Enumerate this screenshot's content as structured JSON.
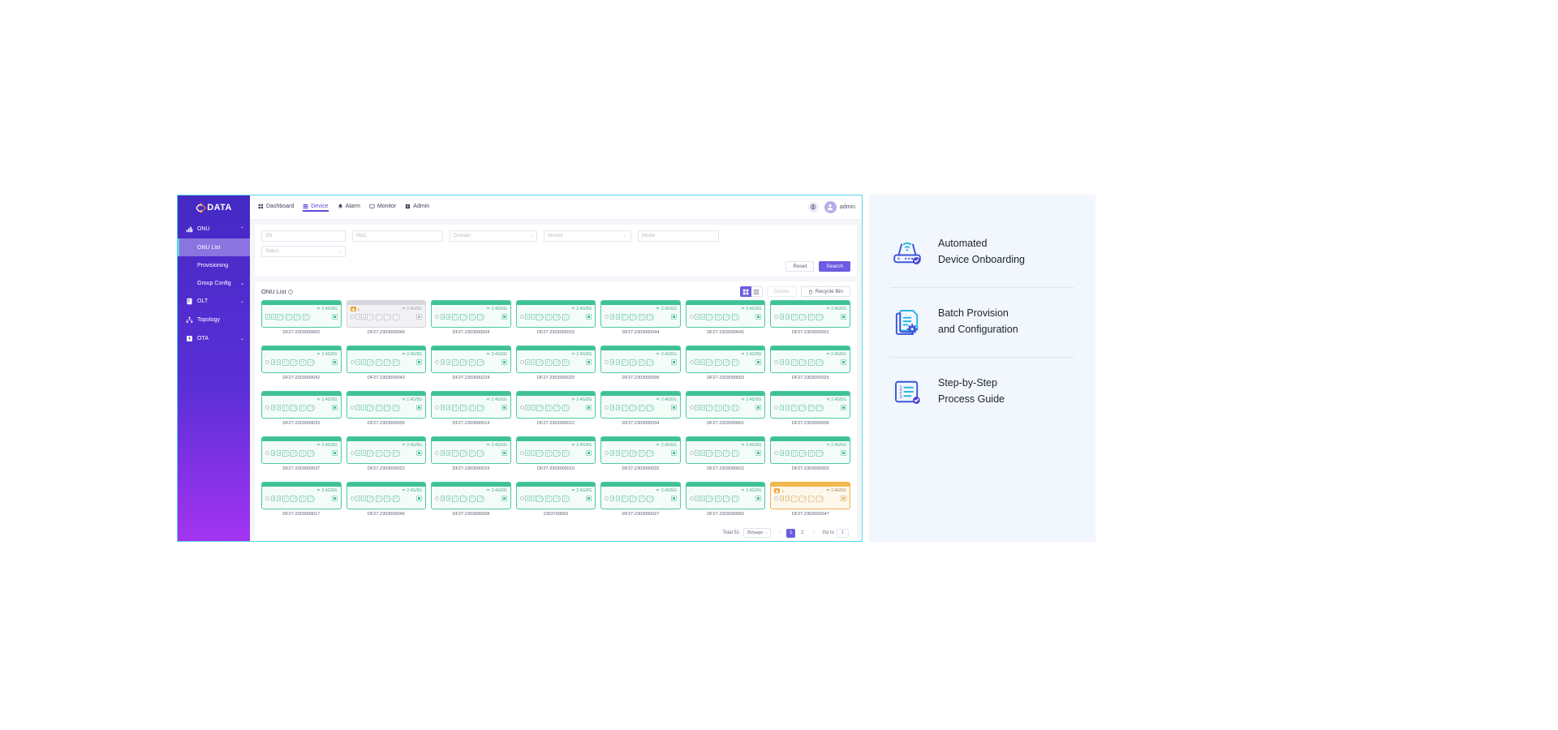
{
  "brand": {
    "name": "DATA",
    "logo_icon": "cdata-diamond-logo"
  },
  "sidebar": {
    "groups": [
      {
        "label": "ONU",
        "icon": "onu-device-icon",
        "expanded": true,
        "caret": "⌃",
        "children": [
          {
            "label": "ONU List",
            "active": true
          },
          {
            "label": "Provisioning",
            "active": false
          },
          {
            "label": "Group Config",
            "active": false,
            "caret": "⌄"
          }
        ]
      },
      {
        "label": "OLT",
        "icon": "olt-rack-icon",
        "caret": "⌄",
        "children": []
      },
      {
        "label": "Topology",
        "icon": "topology-icon",
        "caret": "",
        "children": []
      },
      {
        "label": "OTA",
        "icon": "ota-upgrade-icon",
        "caret": "⌄",
        "children": []
      }
    ]
  },
  "topnav": {
    "items": [
      {
        "label": "Dashboard",
        "icon": "dashboard-grid-icon",
        "active": false
      },
      {
        "label": "Device",
        "icon": "device-stack-icon",
        "active": true
      },
      {
        "label": "Alarm",
        "icon": "alarm-bell-icon",
        "active": false
      },
      {
        "label": "Monitor",
        "icon": "monitor-screen-icon",
        "active": false
      },
      {
        "label": "Admin",
        "icon": "admin-shield-icon",
        "active": false
      }
    ],
    "language_icon": "globe-icon",
    "avatar_icon": "user-avatar-icon",
    "user": "admin"
  },
  "filters": {
    "sn": {
      "placeholder": "SN",
      "value": ""
    },
    "mac": {
      "placeholder": "MAC",
      "value": ""
    },
    "domain": {
      "placeholder": "Domain",
      "value": "",
      "chevron": "⌄"
    },
    "vendor": {
      "placeholder": "Vendor",
      "value": "",
      "chevron": "⌄"
    },
    "model": {
      "placeholder": "Model",
      "value": ""
    },
    "status": {
      "placeholder": "Status",
      "value": "",
      "chevron": "⌄"
    },
    "reset_label": "Reset",
    "search_label": "Search"
  },
  "list": {
    "title": "ONU List",
    "info_icon": "info-circle-icon",
    "grid_view_icon": "grid-view-icon",
    "list_view_icon": "list-view-icon",
    "grid_active": true,
    "delete_label": "Delete",
    "delete_disabled": true,
    "recycle_label": "Recycle Bin",
    "recycle_icon": "trash-icon",
    "wifi_icon": "wifi-icon",
    "alarm_icon": "alarm-triangle-icon"
  },
  "devices": [
    {
      "sn": "DF27-2303000002",
      "state": "online",
      "wifi": "2.4G/5G",
      "leds": 0,
      "small_ports": 2,
      "large_ports": 4,
      "alarm": null
    },
    {
      "sn": "DF27-2303000045",
      "state": "offline",
      "wifi": "2.4G/5G",
      "leds": 1,
      "small_ports": 2,
      "large_ports": 4,
      "alarm": "1"
    },
    {
      "sn": "DF27-2303000004",
      "state": "online",
      "wifi": "2.4G/5G",
      "leds": 1,
      "small_ports": 2,
      "large_ports": 4,
      "alarm": null
    },
    {
      "sn": "DF27-2303000015",
      "state": "online",
      "wifi": "2.4G/5G",
      "leds": 1,
      "small_ports": 2,
      "large_ports": 4,
      "alarm": null
    },
    {
      "sn": "DF27-2303000044",
      "state": "online",
      "wifi": "2.4G/5G",
      "leds": 1,
      "small_ports": 2,
      "large_ports": 4,
      "alarm": null
    },
    {
      "sn": "DF27-2303000041",
      "state": "online",
      "wifi": "2.4G/5G",
      "leds": 1,
      "small_ports": 2,
      "large_ports": 4,
      "alarm": null
    },
    {
      "sn": "DF27-2303000001",
      "state": "online",
      "wifi": "2.4G/5G",
      "leds": 1,
      "small_ports": 2,
      "large_ports": 4,
      "alarm": null
    },
    {
      "sn": "DF27-2303000042",
      "state": "online",
      "wifi": "2.4G/5G",
      "leds": 1,
      "small_ports": 2,
      "large_ports": 4,
      "alarm": null
    },
    {
      "sn": "DF27-2303000043",
      "state": "online",
      "wifi": "2.4G/5G",
      "leds": 1,
      "small_ports": 2,
      "large_ports": 4,
      "alarm": null
    },
    {
      "sn": "DF27-2303000224",
      "state": "online",
      "wifi": "2.4G/5G",
      "leds": 1,
      "small_ports": 2,
      "large_ports": 4,
      "alarm": null
    },
    {
      "sn": "DF27-2303000029",
      "state": "online",
      "wifi": "2.4G/5G",
      "leds": 1,
      "small_ports": 2,
      "large_ports": 4,
      "alarm": null
    },
    {
      "sn": "DF27-2303000006",
      "state": "online",
      "wifi": "2.4G/5G",
      "leds": 1,
      "small_ports": 2,
      "large_ports": 4,
      "alarm": null
    },
    {
      "sn": "DF27-2303000003",
      "state": "online",
      "wifi": "2.4G/5G",
      "leds": 1,
      "small_ports": 2,
      "large_ports": 4,
      "alarm": null
    },
    {
      "sn": "DF27-2303000025",
      "state": "online",
      "wifi": "2.4G/5G",
      "leds": 1,
      "small_ports": 2,
      "large_ports": 4,
      "alarm": null
    },
    {
      "sn": "DF27-2303000033",
      "state": "online",
      "wifi": "2.4G/5G",
      "leds": 1,
      "small_ports": 2,
      "large_ports": 4,
      "alarm": null
    },
    {
      "sn": "DF27-2303000005",
      "state": "online",
      "wifi": "2.4G/5G",
      "leds": 1,
      "small_ports": 2,
      "large_ports": 4,
      "alarm": null
    },
    {
      "sn": "DF27-2303000014",
      "state": "online",
      "wifi": "2.4G/5G",
      "leds": 1,
      "small_ports": 2,
      "large_ports": 4,
      "alarm": null
    },
    {
      "sn": "DF27-2303000012",
      "state": "online",
      "wifi": "2.4G/5G",
      "leds": 1,
      "small_ports": 2,
      "large_ports": 4,
      "alarm": null
    },
    {
      "sn": "DF27-2303000034",
      "state": "online",
      "wifi": "2.4G/5G",
      "leds": 1,
      "small_ports": 2,
      "large_ports": 4,
      "alarm": null
    },
    {
      "sn": "DF27-2303000001",
      "state": "online",
      "wifi": "2.4G/5G",
      "leds": 1,
      "small_ports": 2,
      "large_ports": 4,
      "alarm": null
    },
    {
      "sn": "DF27-2303000006",
      "state": "online",
      "wifi": "2.4G/5G",
      "leds": 1,
      "small_ports": 2,
      "large_ports": 4,
      "alarm": null
    },
    {
      "sn": "DF27-2303000037",
      "state": "online",
      "wifi": "2.4G/5G",
      "leds": 1,
      "small_ports": 2,
      "large_ports": 4,
      "alarm": null
    },
    {
      "sn": "DF27-2303000022",
      "state": "online",
      "wifi": "2.4G/5G",
      "leds": 1,
      "small_ports": 2,
      "large_ports": 4,
      "alarm": null
    },
    {
      "sn": "DF27-2303000019",
      "state": "online",
      "wifi": "2.4G/5G",
      "leds": 1,
      "small_ports": 2,
      "large_ports": 4,
      "alarm": null
    },
    {
      "sn": "DF27-2303000010",
      "state": "online",
      "wifi": "2.4G/5G",
      "leds": 1,
      "small_ports": 2,
      "large_ports": 4,
      "alarm": null
    },
    {
      "sn": "DF27-2303000032",
      "state": "online",
      "wifi": "2.4G/5G",
      "leds": 1,
      "small_ports": 2,
      "large_ports": 4,
      "alarm": null
    },
    {
      "sn": "DF27-2303000021",
      "state": "online",
      "wifi": "2.4G/5G",
      "leds": 1,
      "small_ports": 2,
      "large_ports": 4,
      "alarm": null
    },
    {
      "sn": "DF27-2303000003",
      "state": "online",
      "wifi": "2.4G/5G",
      "leds": 1,
      "small_ports": 2,
      "large_ports": 4,
      "alarm": null
    },
    {
      "sn": "DF27-2303000017",
      "state": "online",
      "wifi": "2.4G/5G",
      "leds": 1,
      "small_ports": 2,
      "large_ports": 4,
      "alarm": null
    },
    {
      "sn": "DF27-2303000046",
      "state": "online",
      "wifi": "2.4G/5G",
      "leds": 1,
      "small_ports": 2,
      "large_ports": 4,
      "alarm": null
    },
    {
      "sn": "DF27-2303000008",
      "state": "online",
      "wifi": "2.4G/5G",
      "leds": 1,
      "small_ports": 2,
      "large_ports": 4,
      "alarm": null
    },
    {
      "sn": "2303700002",
      "state": "online",
      "wifi": "2.4G/5G",
      "leds": 1,
      "small_ports": 2,
      "large_ports": 4,
      "alarm": null
    },
    {
      "sn": "DF27-2303000027",
      "state": "online",
      "wifi": "2.4G/5G",
      "leds": 1,
      "small_ports": 2,
      "large_ports": 4,
      "alarm": null
    },
    {
      "sn": "DF27-2303000050",
      "state": "online",
      "wifi": "2.4G/5G",
      "leds": 1,
      "small_ports": 2,
      "large_ports": 4,
      "alarm": null
    },
    {
      "sn": "DF27-2303000047",
      "state": "warning",
      "wifi": "2.4G/5G",
      "leds": 1,
      "small_ports": 2,
      "large_ports": 4,
      "alarm": "1"
    }
  ],
  "pagination": {
    "total_label": "Total 51",
    "page_size": "35/page",
    "page_size_chevron": "⌄",
    "prev": "‹",
    "next": "›",
    "pages": [
      "1",
      "2"
    ],
    "current_page": "1",
    "goto_label": "Go to",
    "goto_value": "1"
  },
  "features": [
    {
      "icon": "router-wifi-check-icon",
      "text": "Automated\nDevice Onboarding"
    },
    {
      "icon": "documents-gear-icon",
      "text": "Batch Provision\nand Configuration"
    },
    {
      "icon": "numbered-list-check-icon",
      "text": "Step-by-Step\nProcess Guide"
    }
  ],
  "colors": {
    "brand_purple": "#6c5ce0",
    "sidebar_top": "#4429c4",
    "sidebar_bottom": "#a334f0",
    "online_green": "#3fc197",
    "warning_orange": "#f3b84f",
    "offline_grey": "#d6d8de",
    "panel_bg": "#f2f6fd",
    "icon_blue": "#2f7fe0",
    "icon_cyan": "#29b6e8"
  }
}
